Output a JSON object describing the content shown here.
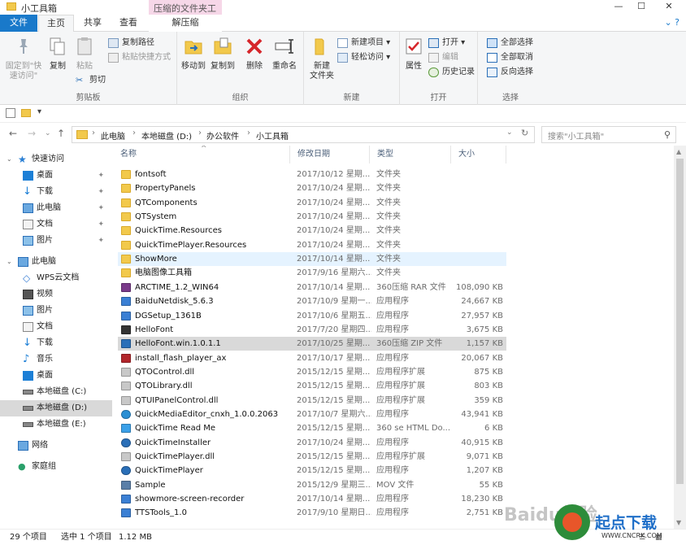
{
  "window": {
    "title": "小工具箱",
    "context_tab_group": "压缩的文件夹工具",
    "controls": {
      "minimize": "—",
      "maximize": "☐",
      "close": "✕"
    }
  },
  "tabs": [
    "文件",
    "主页",
    "共享",
    "查看",
    "解压缩"
  ],
  "ribbon": {
    "clipboard": {
      "pin_quick_access": "固定到\"快\n速访问\"",
      "copy": "复制",
      "paste": "粘贴",
      "copy_path": "复制路径",
      "paste_shortcut": "粘贴快捷方式",
      "cut": "剪切",
      "label": "剪贴板"
    },
    "organize": {
      "move_to": "移动到",
      "copy_to": "复制到",
      "delete": "删除",
      "rename": "重命名",
      "label": "组织"
    },
    "new": {
      "new_folder": "新建\n文件夹",
      "new_item": "新建项目 ▾",
      "easy_access": "轻松访问 ▾",
      "label": "新建"
    },
    "open": {
      "properties": "属性",
      "open": "打开 ▾",
      "edit": "编辑",
      "history": "历史记录",
      "label": "打开"
    },
    "select": {
      "select_all": "全部选择",
      "select_none": "全部取消",
      "invert": "反向选择",
      "label": "选择"
    }
  },
  "address": {
    "crumbs": [
      "此电脑",
      "本地磁盘 (D:)",
      "办公软件",
      "小工具箱"
    ],
    "search_placeholder": "搜索\"小工具箱\""
  },
  "nav": {
    "quick_access": "快速访问",
    "quick_items": [
      "桌面",
      "下载",
      "此电脑",
      "文档",
      "图片"
    ],
    "this_pc": "此电脑",
    "pc_items": [
      "WPS云文档",
      "视频",
      "图片",
      "文档",
      "下载",
      "音乐",
      "桌面",
      "本地磁盘 (C:)",
      "本地磁盘 (D:)",
      "本地磁盘 (E:)"
    ],
    "network": "网络",
    "homegroup": "家庭组"
  },
  "columns": {
    "name": "名称",
    "date": "修改日期",
    "type": "类型",
    "size": "大小"
  },
  "files": [
    {
      "name": "fontsoft",
      "date": "2017/10/12 星期...",
      "type": "文件夹",
      "size": "",
      "icon": "folder"
    },
    {
      "name": "PropertyPanels",
      "date": "2017/10/24 星期...",
      "type": "文件夹",
      "size": "",
      "icon": "folder"
    },
    {
      "name": "QTComponents",
      "date": "2017/10/24 星期...",
      "type": "文件夹",
      "size": "",
      "icon": "folder"
    },
    {
      "name": "QTSystem",
      "date": "2017/10/24 星期...",
      "type": "文件夹",
      "size": "",
      "icon": "folder"
    },
    {
      "name": "QuickTime.Resources",
      "date": "2017/10/24 星期...",
      "type": "文件夹",
      "size": "",
      "icon": "folder"
    },
    {
      "name": "QuickTimePlayer.Resources",
      "date": "2017/10/24 星期...",
      "type": "文件夹",
      "size": "",
      "icon": "folder"
    },
    {
      "name": "ShowMore",
      "date": "2017/10/14 星期...",
      "type": "文件夹",
      "size": "",
      "icon": "folder"
    },
    {
      "name": "电脑图像工具箱",
      "date": "2017/9/16 星期六...",
      "type": "文件夹",
      "size": "",
      "icon": "folder"
    },
    {
      "name": "ARCTIME_1.2_WIN64",
      "date": "2017/10/14 星期...",
      "type": "360压缩 RAR 文件",
      "size": "108,090 KB",
      "icon": "rar"
    },
    {
      "name": "BaiduNetdisk_5.6.3",
      "date": "2017/10/9 星期一...",
      "type": "应用程序",
      "size": "24,667 KB",
      "icon": "app"
    },
    {
      "name": "DGSetup_1361B",
      "date": "2017/10/6 星期五...",
      "type": "应用程序",
      "size": "27,957 KB",
      "icon": "app"
    },
    {
      "name": "HelloFont",
      "date": "2017/7/20 星期四...",
      "type": "应用程序",
      "size": "3,675 KB",
      "icon": "pen"
    },
    {
      "name": "HelloFont.win.1.0.1.1",
      "date": "2017/10/25 星期...",
      "type": "360压缩 ZIP 文件",
      "size": "1,157 KB",
      "icon": "zip"
    },
    {
      "name": "install_flash_player_ax",
      "date": "2017/10/17 星期...",
      "type": "应用程序",
      "size": "20,067 KB",
      "icon": "flash"
    },
    {
      "name": "QTOControl.dll",
      "date": "2015/12/15 星期...",
      "type": "应用程序扩展",
      "size": "875 KB",
      "icon": "dll"
    },
    {
      "name": "QTOLibrary.dll",
      "date": "2015/12/15 星期...",
      "type": "应用程序扩展",
      "size": "803 KB",
      "icon": "dll"
    },
    {
      "name": "QTUIPanelControl.dll",
      "date": "2015/12/15 星期...",
      "type": "应用程序扩展",
      "size": "359 KB",
      "icon": "dll"
    },
    {
      "name": "QuickMediaEditor_cnxh_1.0.0.2063",
      "date": "2017/10/7 星期六...",
      "type": "应用程序",
      "size": "43,941 KB",
      "icon": "media"
    },
    {
      "name": "QuickTime Read Me",
      "date": "2015/12/15 星期...",
      "type": "360 se HTML Do...",
      "size": "6 KB",
      "icon": "html"
    },
    {
      "name": "QuickTimeInstaller",
      "date": "2017/10/24 星期...",
      "type": "应用程序",
      "size": "40,915 KB",
      "icon": "qt"
    },
    {
      "name": "QuickTimePlayer.dll",
      "date": "2015/12/15 星期...",
      "type": "应用程序扩展",
      "size": "9,071 KB",
      "icon": "dll"
    },
    {
      "name": "QuickTimePlayer",
      "date": "2015/12/15 星期...",
      "type": "应用程序",
      "size": "1,207 KB",
      "icon": "qt"
    },
    {
      "name": "Sample",
      "date": "2015/12/9 星期三...",
      "type": "MOV 文件",
      "size": "55 KB",
      "icon": "mov"
    },
    {
      "name": "showmore-screen-recorder",
      "date": "2017/10/14 星期...",
      "type": "应用程序",
      "size": "18,230 KB",
      "icon": "app"
    },
    {
      "name": "TTSTools_1.0",
      "date": "2017/9/10 星期日...",
      "type": "应用程序",
      "size": "2,751 KB",
      "icon": "app"
    }
  ],
  "status": {
    "count": "29 个项目",
    "selected": "选中 1 个项目",
    "size": "1.12 MB"
  },
  "watermarks": {
    "baidu": "Baidu经验",
    "site": "起点下载",
    "site_url": "WWW.CNCRK.COM"
  }
}
